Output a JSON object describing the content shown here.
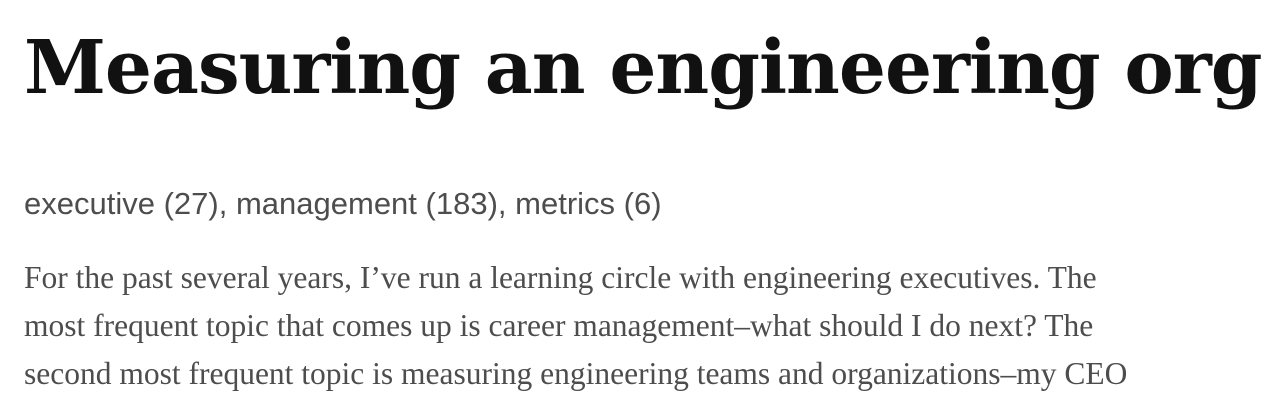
{
  "article": {
    "title": "Measuring an engineering org",
    "tags": [
      {
        "label": "executive",
        "count": "(27)",
        "sep": ", "
      },
      {
        "label": "management",
        "count": "(183)",
        "sep": ", "
      },
      {
        "label": "metrics",
        "count": "(6)",
        "sep": ""
      }
    ],
    "body_lines": [
      "For the past several years, I’ve run a learning circle with engineering executives. The",
      "most frequent topic that comes up is career management–what should I do next? The",
      "second most frequent topic is measuring engineering teams and organizations–my CEO"
    ]
  }
}
